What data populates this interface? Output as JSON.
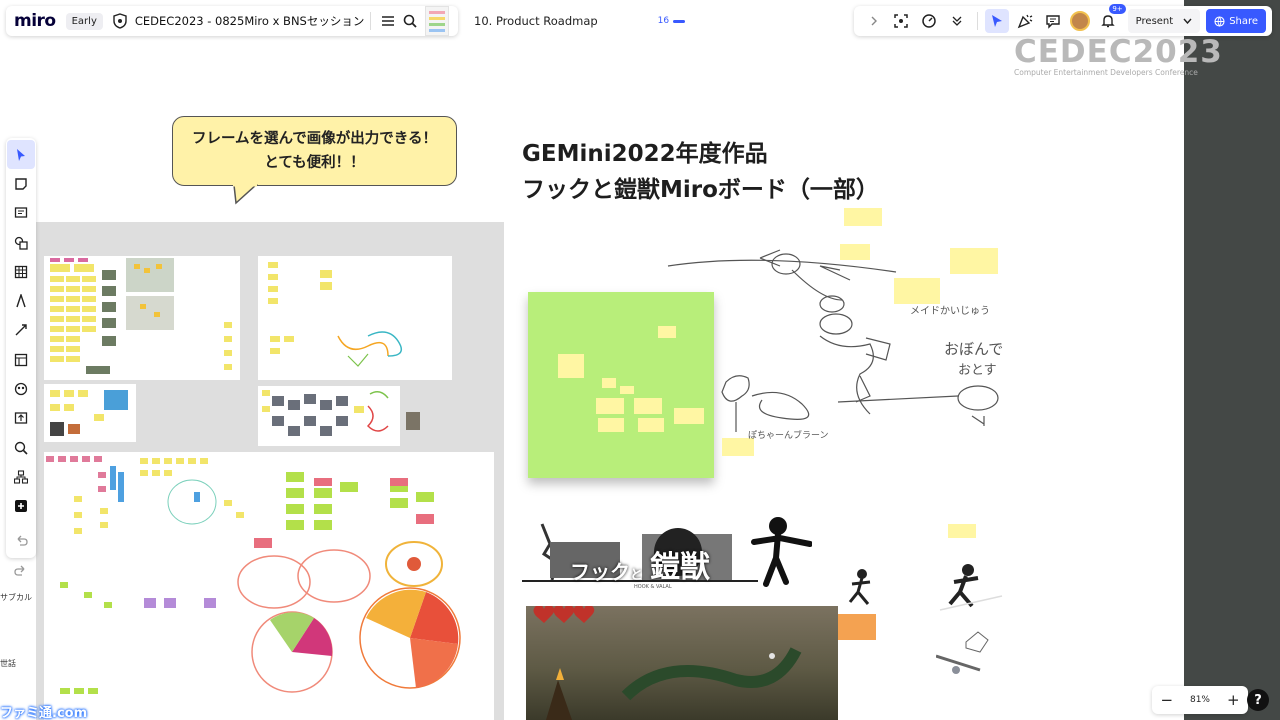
{
  "topbar": {
    "logo": "miro",
    "plan_badge": "Early",
    "board_name": "CEDEC2023 - 0825Miro x BNSセッション",
    "frame_title": "10. Product Roadmap",
    "frame_count": "16",
    "present_label": "Present",
    "share_label": "Share",
    "notification_count": "9+"
  },
  "icons": {
    "menu": "menu-icon",
    "search": "search-icon",
    "shield": "shield-icon",
    "fit": "fit-screen-icon",
    "timer": "timer-icon",
    "more": "chevron-down-icon",
    "select": "cursor-icon",
    "celebrate": "party-icon",
    "comment": "comment-icon",
    "bell": "bell-icon",
    "globe": "globe-icon"
  },
  "branding": {
    "event_logo": "CEDEC2023",
    "event_subtitle": "Computer Entertainment Developers Conference",
    "watermark": "ファミ通.com"
  },
  "toolbar": {
    "tools": [
      "select",
      "sticky-note",
      "text",
      "shapes",
      "table",
      "pen",
      "connector",
      "frame",
      "templates",
      "upload",
      "search-zoom",
      "mind-map",
      "more-apps"
    ]
  },
  "side_labels": {
    "label_1": "サブカル",
    "label_2": "世話"
  },
  "bubble": {
    "line1": "フレームを選んで画像が出力できる！",
    "line2": "とても便利！！"
  },
  "heading": {
    "line1": "GEMini2022年度作品",
    "line2": "フックと鎧獣Miroボード（一部）"
  },
  "sketch_notes": {
    "note1": "メイドかいじゅう",
    "note2": "おぼんで",
    "note3": "おとす",
    "note4": "ぽちゃーんブラーン"
  },
  "game_logo": {
    "text1": "フック",
    "text2": "と",
    "text3": "鎧獣",
    "subtitle": "HOOK & VALAL"
  },
  "zoom": {
    "minus": "−",
    "level": "81%",
    "plus": "+",
    "help": "?"
  },
  "colors": {
    "accent": "#3859ff",
    "sticky_yellow": "#fff6a3",
    "bubble_fill": "#fff2a8",
    "green_frame": "#b8ee7a",
    "dark_panel": "#444846"
  }
}
